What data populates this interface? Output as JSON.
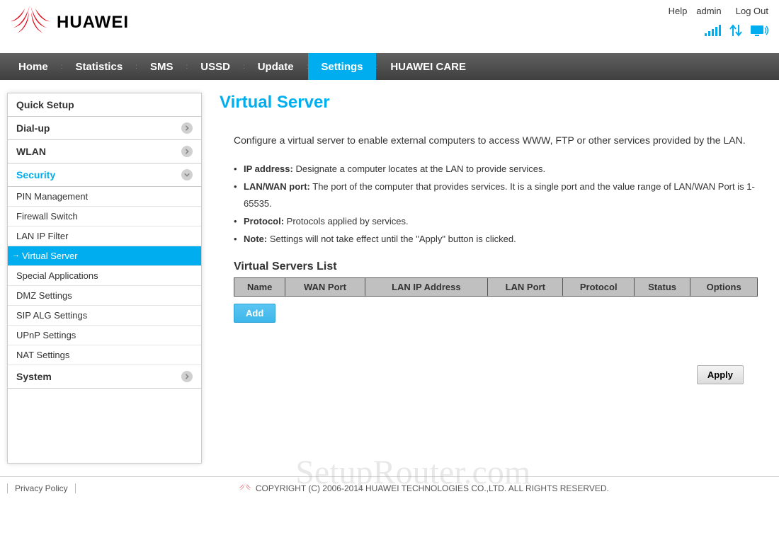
{
  "header": {
    "brand": "HUAWEI",
    "help": "Help",
    "user": "admin",
    "logout": "Log Out"
  },
  "nav": {
    "items": [
      "Home",
      "Statistics",
      "SMS",
      "USSD",
      "Update",
      "Settings",
      "HUAWEI CARE"
    ],
    "active_index": 5
  },
  "sidebar": {
    "quick_setup": "Quick Setup",
    "dialup": "Dial-up",
    "wlan": "WLAN",
    "security": "Security",
    "security_items": [
      "PIN Management",
      "Firewall Switch",
      "LAN IP Filter",
      "Virtual Server",
      "Special Applications",
      "DMZ Settings",
      "SIP ALG Settings",
      "UPnP Settings",
      "NAT Settings"
    ],
    "security_active_index": 3,
    "system": "System"
  },
  "page": {
    "title": "Virtual Server",
    "intro": "Configure a virtual server to enable external computers to access WWW, FTP or other services provided by the LAN.",
    "bullets": {
      "ip_label": "IP address:",
      "ip_text": " Designate a computer locates at the LAN to provide services.",
      "port_label": "LAN/WAN port:",
      "port_text": " The port of the computer that provides services. It is a single port and the value range of LAN/WAN Port is 1-65535.",
      "proto_label": "Protocol:",
      "proto_text": " Protocols applied by services.",
      "note_label": "Note:",
      "note_text": " Settings will not take effect until the \"Apply\" button is clicked."
    },
    "list_title": "Virtual Servers List",
    "columns": [
      "Name",
      "WAN Port",
      "LAN IP Address",
      "LAN Port",
      "Protocol",
      "Status",
      "Options"
    ],
    "add_btn": "Add",
    "apply_btn": "Apply"
  },
  "footer": {
    "privacy": "Privacy Policy",
    "copyright": "COPYRIGHT (C) 2006-2014 HUAWEI TECHNOLOGIES CO.,LTD. ALL RIGHTS RESERVED."
  },
  "watermark": "SetupRouter.com"
}
